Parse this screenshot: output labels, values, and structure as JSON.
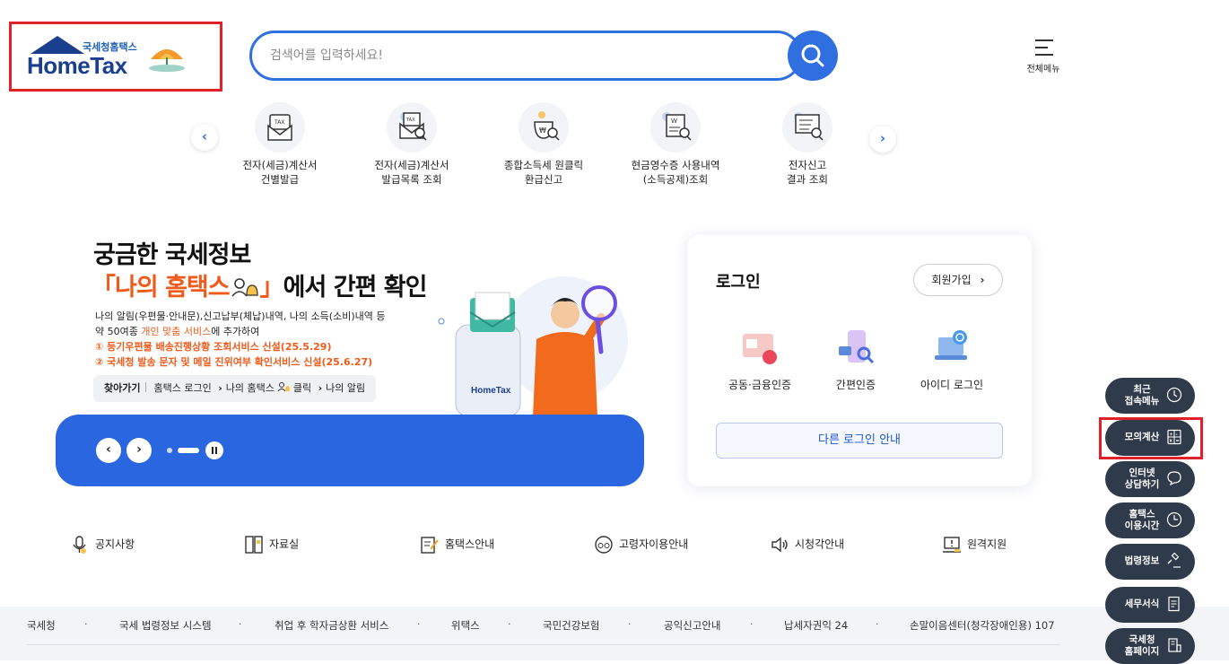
{
  "header": {
    "logo_small": "국세청홈택스",
    "logo_big": "HomeTax",
    "search_placeholder": "검색어를 입력하세요!",
    "menu_label": "전체메뉴"
  },
  "quick_menu": {
    "items": [
      {
        "line1": "전자(세금)계산서",
        "line2": "건별발급",
        "icon": "tax-invoice-icon"
      },
      {
        "line1": "전자(세금)계산서",
        "line2": "발급목록 조회",
        "icon": "tax-search-icon"
      },
      {
        "line1": "종합소득세 원클릭",
        "line2": "환급신고",
        "icon": "refund-search-icon"
      },
      {
        "line1": "현금영수증 사용내역",
        "line2": "(소득공제)조회",
        "icon": "receipt-search-icon"
      },
      {
        "line1": "전자신고",
        "line2": "결과 조회",
        "icon": "report-search-icon"
      }
    ],
    "prev_icon": "‹",
    "next_icon": "›"
  },
  "banner": {
    "title1": "궁금한 국세정보",
    "title2_orange": "「나의 홈택스",
    "title2_orange_end": "」",
    "title2_rest": "에서 간편 확인",
    "desc1": "나의 알림(우편물·안내문),신고납부(체납)내역, 나의 소득(소비)내역 등",
    "desc2_pre": "약 50여종 ",
    "desc2_orange": "개인 맞춤 서비스",
    "desc2_post": "에 추가하여",
    "note1": "① 등기우편물 배송진행상황 조회서비스 신설(25.5.29)",
    "note2": "② 국세청 발송 문자 및 메일 진위여부 확인서비스 신설(25.6.27)",
    "path_label": "찾아가기",
    "path1": "홈택스 로그인",
    "path2": "나의 홈택스",
    "path3": "클릭",
    "path4": "나의 알림",
    "arrow": "›",
    "phone_logo": "HomeTax"
  },
  "login": {
    "title": "로그인",
    "join": "회원가입",
    "join_arrow": "›",
    "options": [
      "공동·금융인증",
      "간편인증",
      "아이디 로그인"
    ],
    "other": "다른 로그인 안내"
  },
  "links": [
    "공지사항",
    "자료실",
    "홈택스안내",
    "고령자이용안내",
    "시청각안내",
    "원격지원"
  ],
  "footer": [
    "국세청",
    "국세 법령정보 시스템",
    "취업 후 학자금상환 서비스",
    "위택스",
    "국민건강보험",
    "공익신고안내",
    "납세자권익 24",
    "손말이음센터(청각장애인용) 107"
  ],
  "footer_sep": "·",
  "side": [
    {
      "line1": "최근",
      "line2": "접속메뉴",
      "icon": "clock-icon"
    },
    {
      "line1": "모의계산",
      "line2": "",
      "icon": "calculator-icon"
    },
    {
      "line1": "인터넷",
      "line2": "상담하기",
      "icon": "chat-icon"
    },
    {
      "line1": "홈택스",
      "line2": "이용시간",
      "icon": "time-icon"
    },
    {
      "line1": "법령정보",
      "line2": "",
      "icon": "gavel-icon"
    },
    {
      "line1": "세무서식",
      "line2": "",
      "icon": "form-icon"
    },
    {
      "line1": "국세청",
      "line2": "홈페이지",
      "icon": "building-icon"
    }
  ],
  "colors": {
    "brand": "#2f6fe0",
    "accent": "#f05a1a",
    "highlight": "#e0202a",
    "side": "#2f3a4a"
  }
}
